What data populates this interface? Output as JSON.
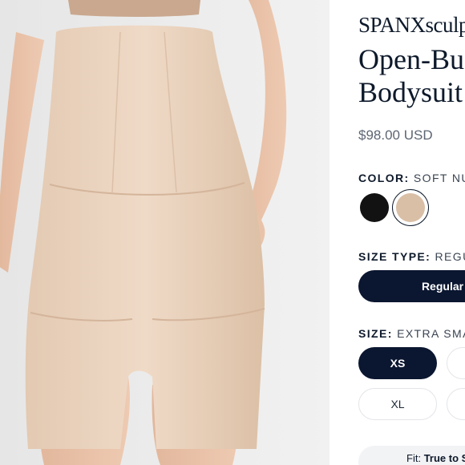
{
  "product": {
    "brand": "SPANXsculpt",
    "title_line1": "Open-Bust",
    "title_line2": "Bodysuit",
    "price": "$98.00 USD"
  },
  "color": {
    "label": "COLOR:",
    "selected": "SOFT NUDE",
    "swatches": [
      {
        "name": "Black",
        "hex": "#121212"
      },
      {
        "name": "Soft Nude",
        "hex": "#d9bfa6"
      }
    ]
  },
  "size_type": {
    "label": "SIZE TYPE:",
    "selected": "REGULAR",
    "options": [
      "Regular"
    ]
  },
  "size": {
    "label": "SIZE:",
    "selected": "EXTRA SMALL",
    "options": [
      "XS",
      "",
      "XL",
      ""
    ]
  },
  "fit": {
    "label": "Fit:",
    "value": "True to S"
  },
  "colors": {
    "navy": "#0b1630",
    "text": "#0e1a2b",
    "muted": "#5d6673"
  }
}
